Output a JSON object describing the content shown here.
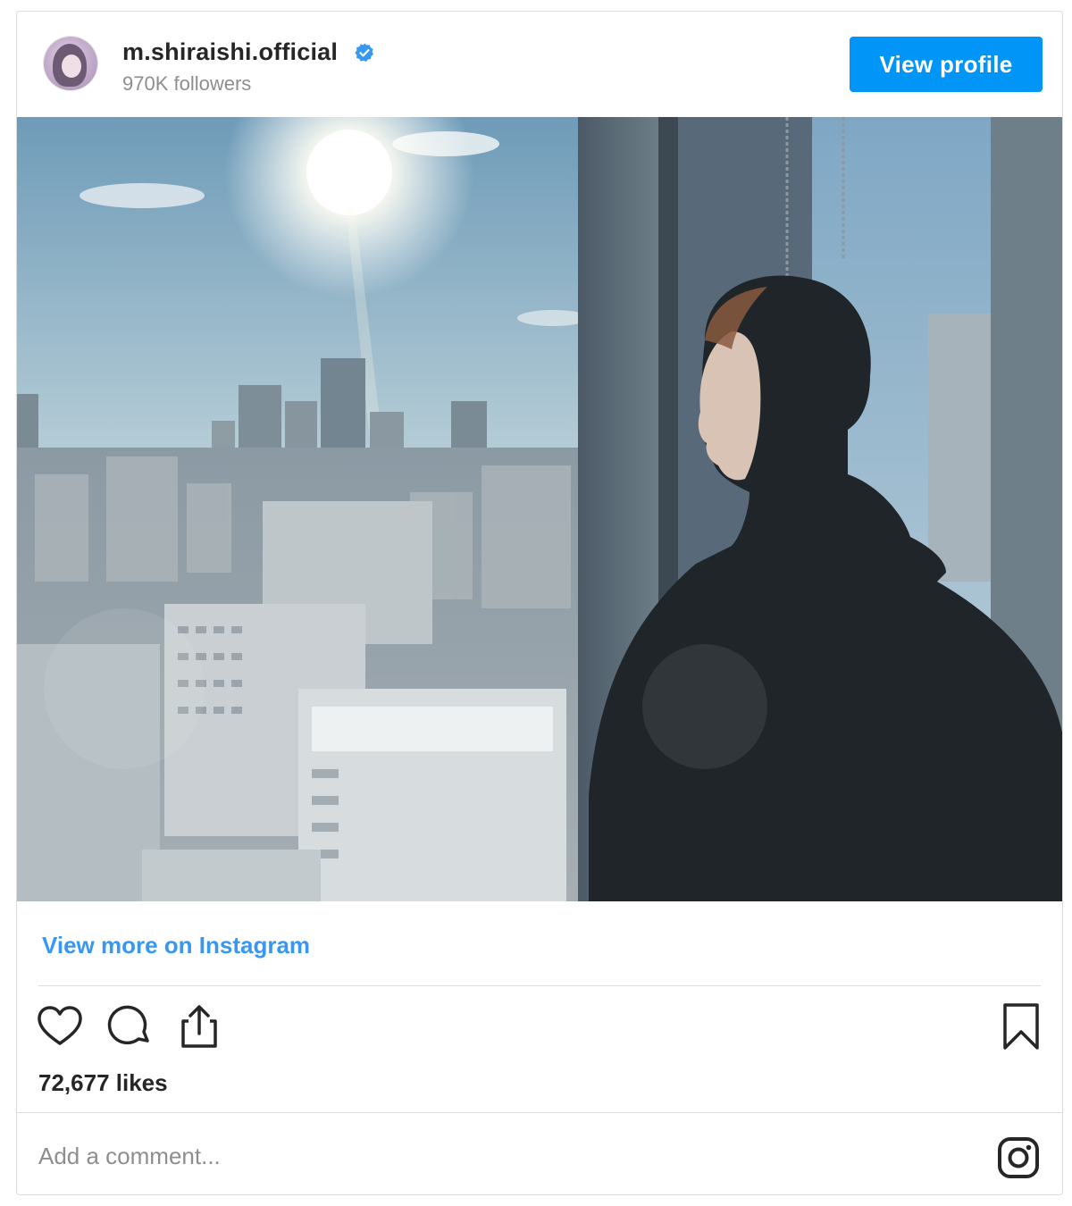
{
  "post": {
    "username": "m.shiraishi.official",
    "followers": "970K followers",
    "view_profile_label": "View profile",
    "view_more_label": "View more on Instagram",
    "likes": "72,677 likes",
    "comment_placeholder": "Add a comment..."
  },
  "icons": {
    "verified": "verified-badge-icon",
    "like": "heart-icon",
    "comment": "speech-bubble-icon",
    "share": "share-upload-icon",
    "bookmark": "bookmark-icon",
    "instagram": "instagram-logo-icon"
  },
  "colors": {
    "accent": "#0095f6",
    "link": "#3897f0",
    "text": "#262626",
    "muted": "#8e8e8e",
    "border": "#dbdbdb"
  }
}
